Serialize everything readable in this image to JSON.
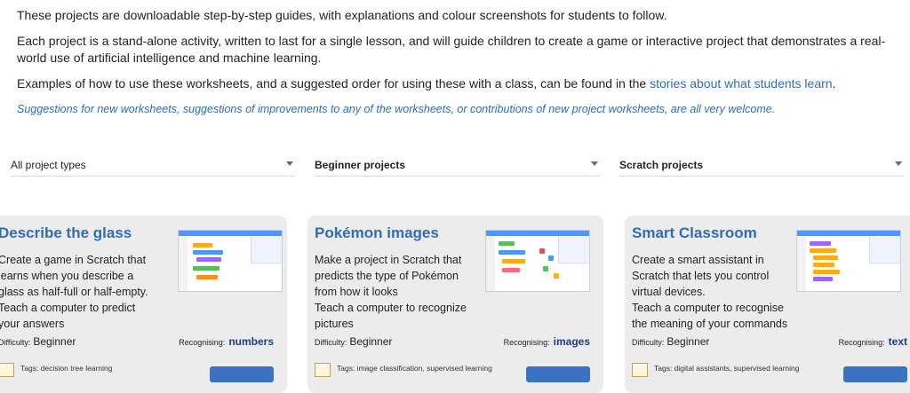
{
  "intro": {
    "line1": "These projects are downloadable step-by-step guides, with explanations and colour screenshots for students to follow.",
    "line2": "Each project is a stand-alone activity, written to last for a single lesson, and will guide children to create a game or interactive project that demonstrates a real-world use of artificial intelligence and machine learning.",
    "line3_prefix": "Examples of how to use these worksheets, and a suggested order for using these with a class, can be found in the ",
    "line3_link": "stories about what students learn",
    "line3_suffix": ".",
    "suggestions": "Suggestions for new worksheets, suggestions of improvements to any of the worksheets, or contributions of new project worksheets, are all very welcome."
  },
  "filters": [
    {
      "value": "All project types"
    },
    {
      "value": "Beginner projects"
    },
    {
      "value": "Scratch projects"
    }
  ],
  "cards": [
    {
      "title": "Describe the glass",
      "description": "Create a game in Scratch that learns when you describe a glass as half-full or half-empty.",
      "teach": "Teach a computer to predict your answers",
      "difficulty_label": "Difficulty:",
      "difficulty": "Beginner",
      "recognising_label": "Recognising:",
      "recognising": "numbers",
      "tags": "Tags: decision tree learning"
    },
    {
      "title": "Pokémon images",
      "description": "Make a project in Scratch that predicts the type of Pokémon from how it looks",
      "teach": "Teach a computer to recognize pictures",
      "difficulty_label": "Difficulty:",
      "difficulty": "Beginner",
      "recognising_label": "Recognising:",
      "recognising": "images",
      "tags": "Tags: image classification, supervised learning"
    },
    {
      "title": "Smart Classroom",
      "description": "Create a smart assistant in Scratch that lets you control virtual devices.",
      "teach": "Teach a computer to recognise the meaning of your commands",
      "difficulty_label": "Difficulty:",
      "difficulty": "Beginner",
      "recognising_label": "Recognising:",
      "recognising": "text",
      "tags": "Tags: digital assistants, supervised learning"
    }
  ],
  "colors": {
    "link": "#2f6db5",
    "card_bg": "#ececec",
    "button": "#3b73c4",
    "recognising": "#1a3c8a"
  }
}
